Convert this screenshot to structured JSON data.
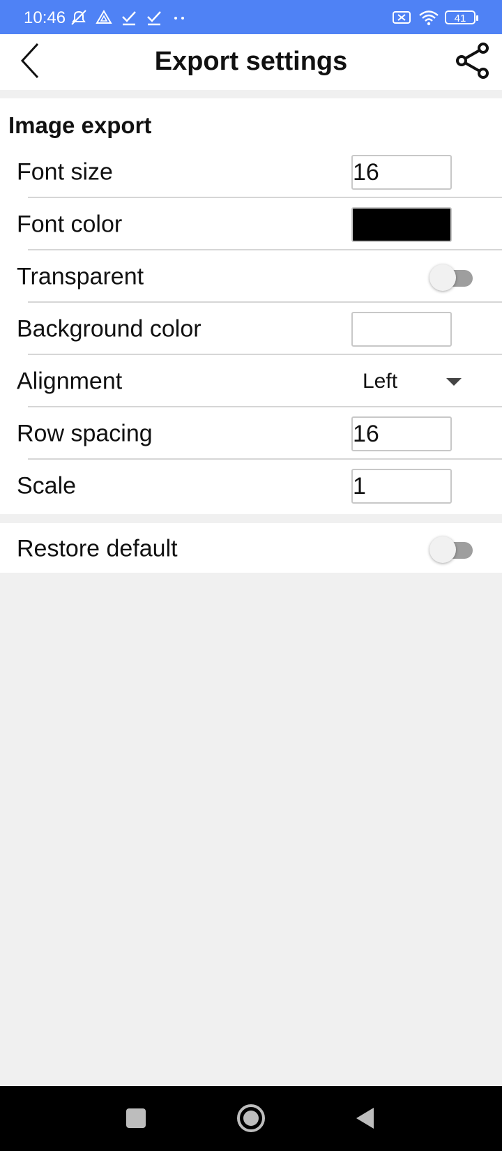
{
  "status_bar": {
    "time": "10:46",
    "battery": "41",
    "icons_left": [
      "muted-alarm-icon",
      "drive-icon",
      "check-icon",
      "check-icon",
      "more-dots-icon"
    ],
    "icons_right": [
      "no-sim-icon",
      "wifi-icon",
      "battery-icon"
    ]
  },
  "app_bar": {
    "title": "Export settings",
    "back_icon": "chevron-left-icon",
    "share_icon": "share-icon"
  },
  "section": {
    "title": "Image export",
    "rows": {
      "font_size": {
        "label": "Font size",
        "value": "16"
      },
      "font_color": {
        "label": "Font color",
        "color": "#000000"
      },
      "transparent": {
        "label": "Transparent",
        "enabled": false
      },
      "background_color": {
        "label": "Background color",
        "color": "#ffffff"
      },
      "alignment": {
        "label": "Alignment",
        "value": "Left"
      },
      "row_spacing": {
        "label": "Row spacing",
        "value": "16"
      },
      "scale": {
        "label": "Scale",
        "value": "1"
      }
    }
  },
  "restore": {
    "label": "Restore default",
    "enabled": false
  },
  "nav_bar": {
    "icons": [
      "recents-square-icon",
      "home-circle-icon",
      "back-triangle-icon"
    ]
  },
  "colors": {
    "status_bar": "#4f82f5",
    "page_background": "#f0f0f0",
    "card_background": "#ffffff",
    "toggle_off_track": "#9e9e9e"
  }
}
